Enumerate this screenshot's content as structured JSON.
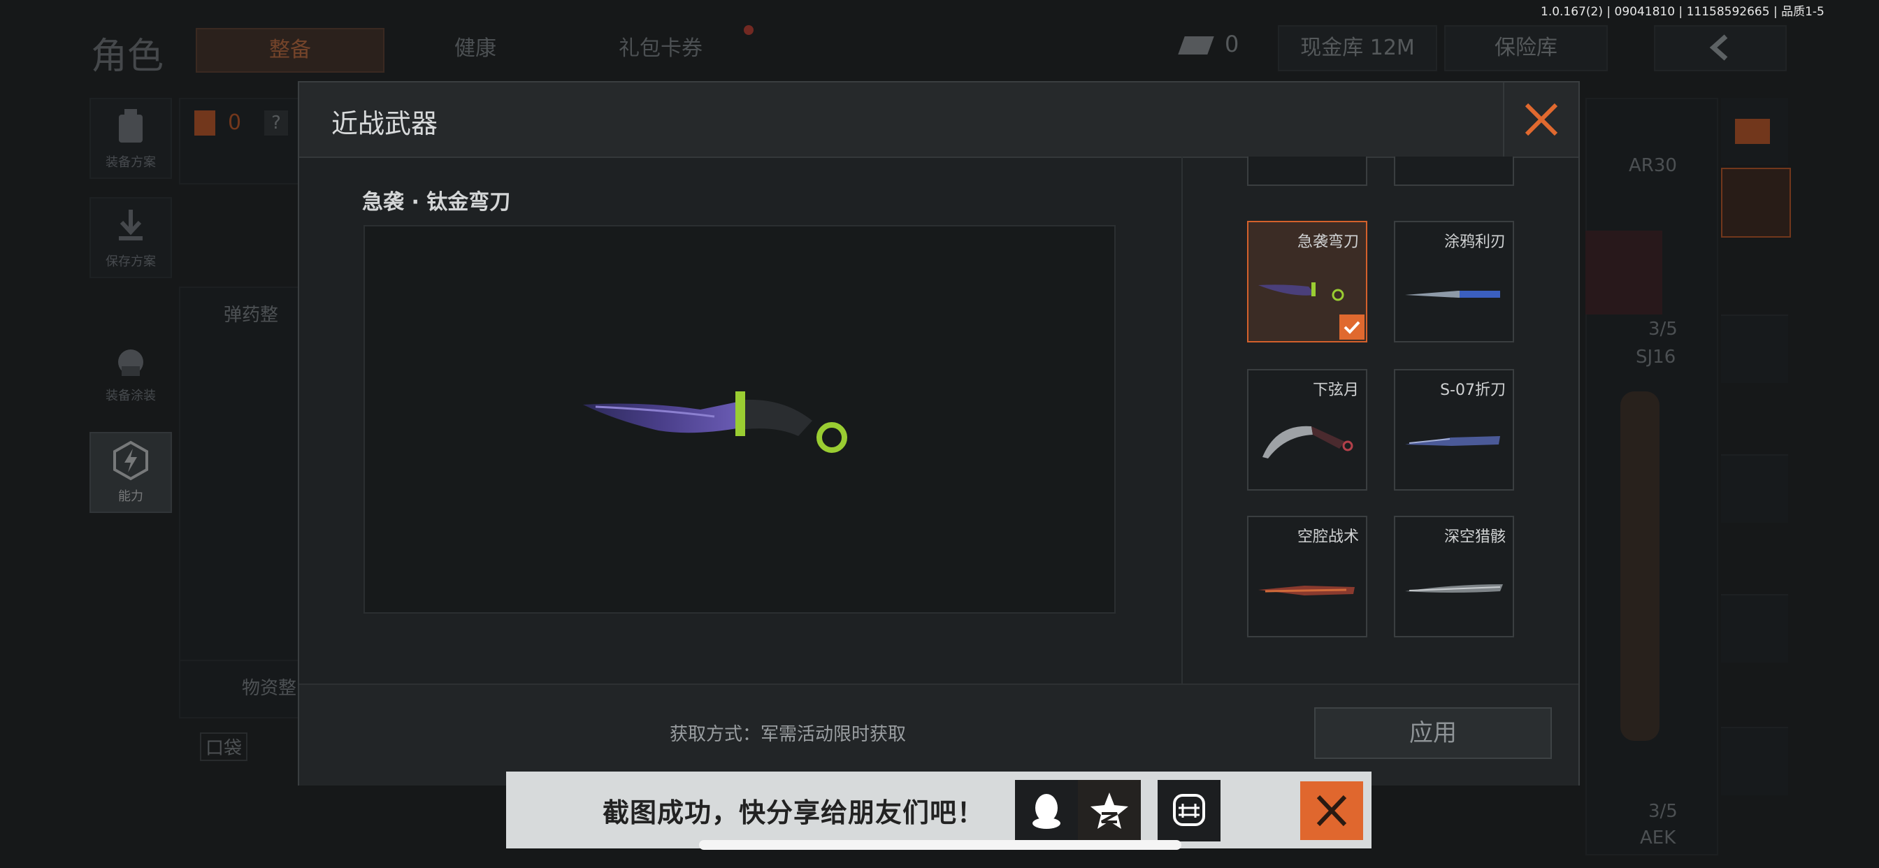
{
  "status": {
    "version": "1.0.167(2) | 09041810 | 11158592665 | 品质1-5"
  },
  "background": {
    "title": "角色",
    "tabs": [
      {
        "label": "整备",
        "active": true
      },
      {
        "label": "健康",
        "active": false
      },
      {
        "label": "礼包卡券",
        "active": false
      }
    ],
    "currency_count": "0",
    "cash_vault": "现金库 12M",
    "safe": "保险库",
    "left_menu": [
      {
        "label": "装备方案",
        "icon": "backpack-icon"
      },
      {
        "label": "保存方案",
        "icon": "download-icon"
      },
      {
        "label": "装备涂装",
        "icon": "helmet-icon"
      },
      {
        "label": "能力",
        "icon": "lightning-icon"
      }
    ],
    "loadout_count": "0",
    "ammo_section": "弹药整",
    "supplies_section": "物资整",
    "pocket": "口袋",
    "weapon_labels": [
      "AR30",
      "3/5",
      "SJ16",
      "3/5",
      "AEK"
    ]
  },
  "modal": {
    "title": "近战武器",
    "preview_title": "急袭 · 钛金弯刀",
    "acquire_text": "获取方式：军需活动限时获取",
    "apply_label": "应用",
    "cards": [
      {
        "name": "急袭弯刀",
        "selected": true
      },
      {
        "name": "涂鸦利刃",
        "selected": false
      },
      {
        "name": "下弦月",
        "selected": false
      },
      {
        "name": "S-07折刀",
        "selected": false
      },
      {
        "name": "空腔战术",
        "selected": false
      },
      {
        "name": "深空猎骸",
        "selected": false
      }
    ]
  },
  "toast": {
    "text": "截图成功，快分享给朋友们吧！",
    "share_targets": [
      "qq-icon",
      "qzone-icon",
      "moments-icon"
    ]
  },
  "colors": {
    "accent": "#e0692f",
    "bg": "#161819",
    "modal": "#1e2123"
  }
}
